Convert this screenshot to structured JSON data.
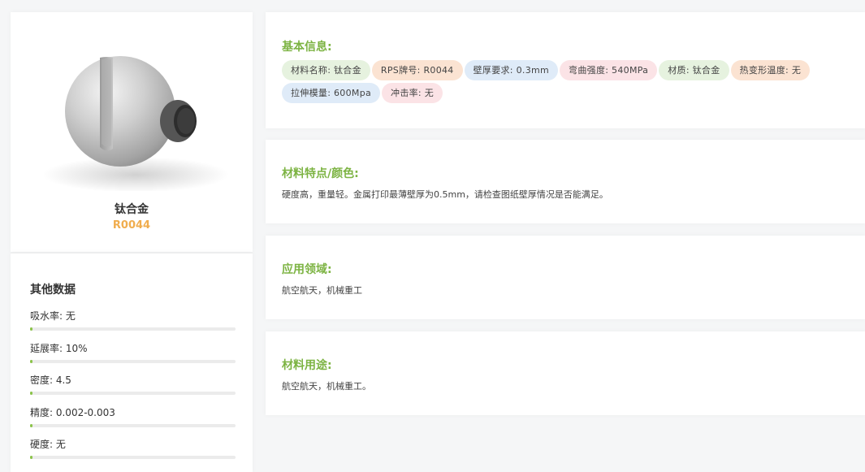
{
  "product": {
    "name": "钛合金",
    "code": "R0044",
    "image_icon": "titanium-ball-joint-image"
  },
  "other_data": {
    "title": "其他数据",
    "items": [
      {
        "text": "吸水率: 无",
        "level": 0
      },
      {
        "text": "延展率: 10%",
        "level": 0.01
      },
      {
        "text": "密度: 4.5",
        "level": 0.01
      },
      {
        "text": "精度: 0.002-0.003",
        "level": 0.01
      },
      {
        "text": "硬度: 无",
        "level": 0.01
      }
    ]
  },
  "basic_info": {
    "title": "基本信息:",
    "tags": [
      {
        "text": "材料名称: 钛合金",
        "color": "green"
      },
      {
        "text": "RPS牌号: R0044",
        "color": "orange"
      },
      {
        "text": "壁厚要求: 0.3mm",
        "color": "blue"
      },
      {
        "text": "弯曲强度: 540MPa",
        "color": "pink"
      },
      {
        "text": "材质: 钛合金",
        "color": "green"
      },
      {
        "text": "热变形温度: 无",
        "color": "orange"
      },
      {
        "text": "拉伸模量: 600Mpa",
        "color": "blue"
      },
      {
        "text": "冲击率: 无",
        "color": "pink"
      }
    ]
  },
  "features": {
    "title": "材料特点/颜色:",
    "text": "硬度高，重量轻。金属打印最薄壁厚为0.5mm，请检查图纸壁厚情况是否能满足。"
  },
  "application": {
    "title": "应用领域:",
    "text": "航空航天，机械重工"
  },
  "usage": {
    "title": "材料用途:",
    "text": "航空航天，机械重工。"
  },
  "colors": {
    "accent_green": "#7cb342",
    "code_orange": "#f0ad4e",
    "tag_green": "#e6f2df",
    "tag_orange": "#fbe3d2",
    "tag_blue": "#dfebf8",
    "tag_pink": "#fbe3e6"
  }
}
